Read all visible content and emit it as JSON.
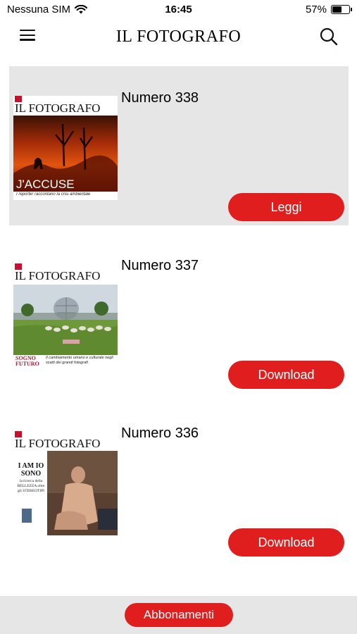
{
  "status_bar": {
    "carrier": "Nessuna SIM",
    "time": "16:45",
    "battery": "57%",
    "battery_level": 0.57
  },
  "header": {
    "title": "IL FOTOGRAFO",
    "menu_icon": "hamburger-menu-icon",
    "search_icon": "search-icon"
  },
  "issues": [
    {
      "name": "Numero 338",
      "button": "Leggi",
      "cover": {
        "masthead": "IL FOTOGRAFO",
        "headline": "J'ACCUSE",
        "subline": "I reporter raccontano la crisi ambientale"
      }
    },
    {
      "name": "Numero 337",
      "button": "Download",
      "cover": {
        "masthead": "IL FOTOGRAFO",
        "headline": "SOGNO FUTURO",
        "subline": "Il cambiamento umano e culturale negli scatti dei grandi fotografi"
      }
    },
    {
      "name": "Numero 336",
      "button": "Download",
      "cover": {
        "masthead": "IL FOTOGRAFO",
        "headline": "I AM IO SONO",
        "subline": "la ricerca della BELLEZZA oltre gli STEREOTIPI"
      }
    }
  ],
  "footer": {
    "subscriptions": "Abbonamenti"
  },
  "colors": {
    "accent": "#e01e1e",
    "selected_bg": "#e6e6e6"
  }
}
